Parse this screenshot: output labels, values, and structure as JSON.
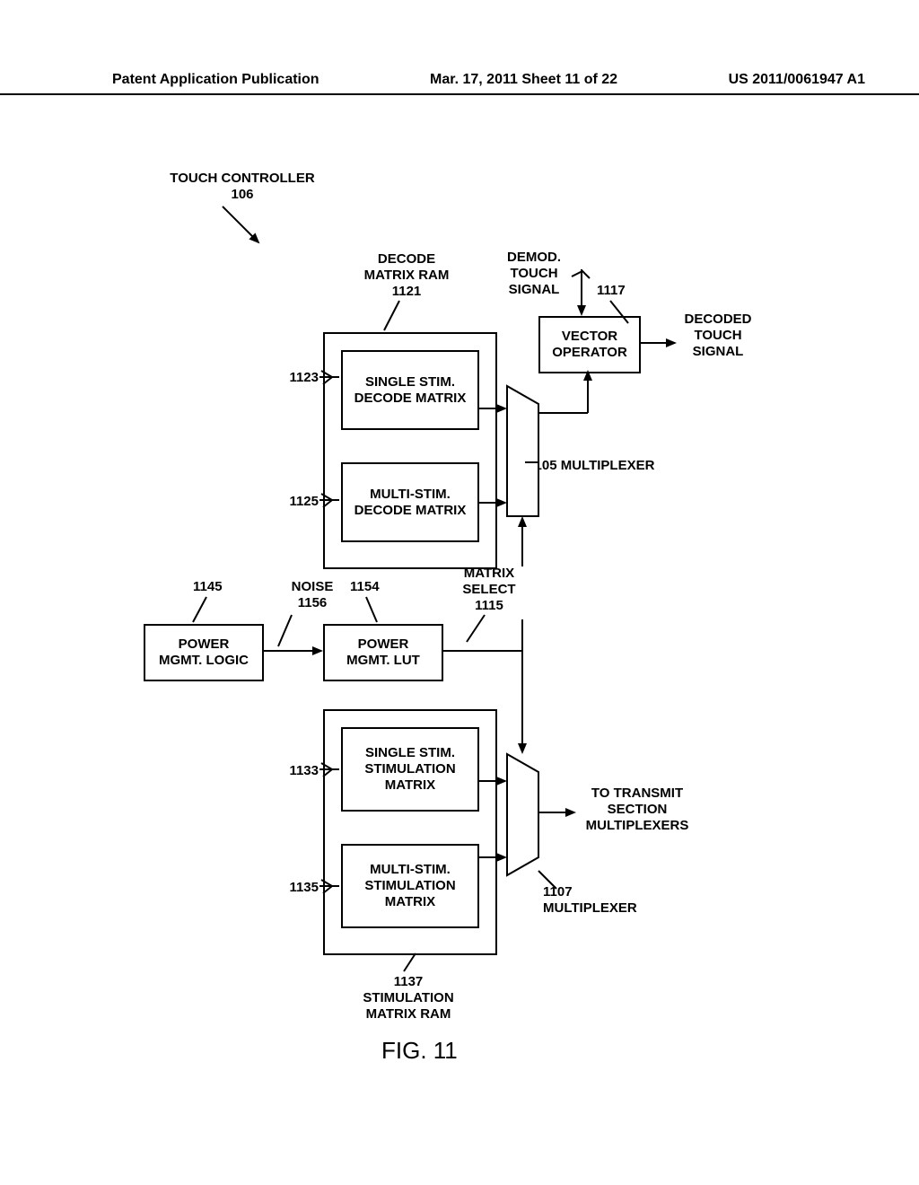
{
  "header": {
    "left": "Patent Application Publication",
    "mid": "Mar. 17, 2011  Sheet 11 of 22",
    "right": "US 2011/0061947 A1"
  },
  "touch_controller": {
    "title_line1": "TOUCH CONTROLLER",
    "title_line2": "106"
  },
  "decode_ram": {
    "title_line1": "DECODE",
    "title_line2": "MATRIX RAM",
    "ref": "1121",
    "single": {
      "l1": "SINGLE STIM.",
      "l2": "DECODE MATRIX"
    },
    "multi": {
      "l1": "MULTI-STIM.",
      "l2": "DECODE MATRIX"
    },
    "single_ref": "1123",
    "multi_ref": "1125"
  },
  "vector_operator": {
    "l1": "VECTOR",
    "l2": "OPERATOR",
    "ref": "1117"
  },
  "demod_in": {
    "l1": "DEMOD.",
    "l2": "TOUCH",
    "l3": "SIGNAL"
  },
  "decoded_out": {
    "l1": "DECODED",
    "l2": "TOUCH",
    "l3": "SIGNAL"
  },
  "mux1": {
    "ref": "1105",
    "label": "MULTIPLEXER"
  },
  "matrix_select": {
    "l1": "MATRIX",
    "l2": "SELECT",
    "ref": "1115"
  },
  "power_logic": {
    "l1": "POWER",
    "l2": "MGMT. LOGIC",
    "ref": "1145"
  },
  "power_lut": {
    "l1": "POWER",
    "l2": "MGMT. LUT",
    "ref": "1154"
  },
  "noise": {
    "l1": "NOISE",
    "ref": "1156"
  },
  "stim_ram": {
    "single": {
      "l1": "SINGLE STIM.",
      "l2": "STIMULATION",
      "l3": "MATRIX"
    },
    "multi": {
      "l1": "MULTI-STIM.",
      "l2": "STIMULATION",
      "l3": "MATRIX"
    },
    "single_ref": "1133",
    "multi_ref": "1135",
    "ref": "1137",
    "title_l1": "STIMULATION",
    "title_l2": "MATRIX RAM"
  },
  "mux2": {
    "ref": "1107",
    "label": "MULTIPLEXER"
  },
  "tx_out": {
    "l1": "TO TRANSMIT",
    "l2": "SECTION",
    "l3": "MULTIPLEXERS"
  },
  "figure": "FIG. 11"
}
